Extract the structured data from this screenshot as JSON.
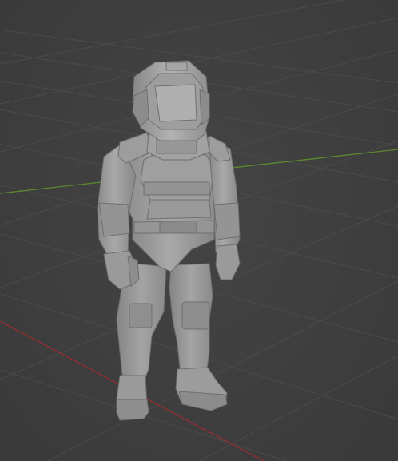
{
  "viewport": {
    "name": "3D Viewport",
    "background": "#3d3d3d",
    "grid_color": "#4a4a4a",
    "x_axis_color": "#8c2f35",
    "y_axis_color": "#5a8a2e",
    "mesh_color": "#9e9e9e"
  },
  "object": {
    "type": "mesh",
    "description": "astronaut"
  }
}
